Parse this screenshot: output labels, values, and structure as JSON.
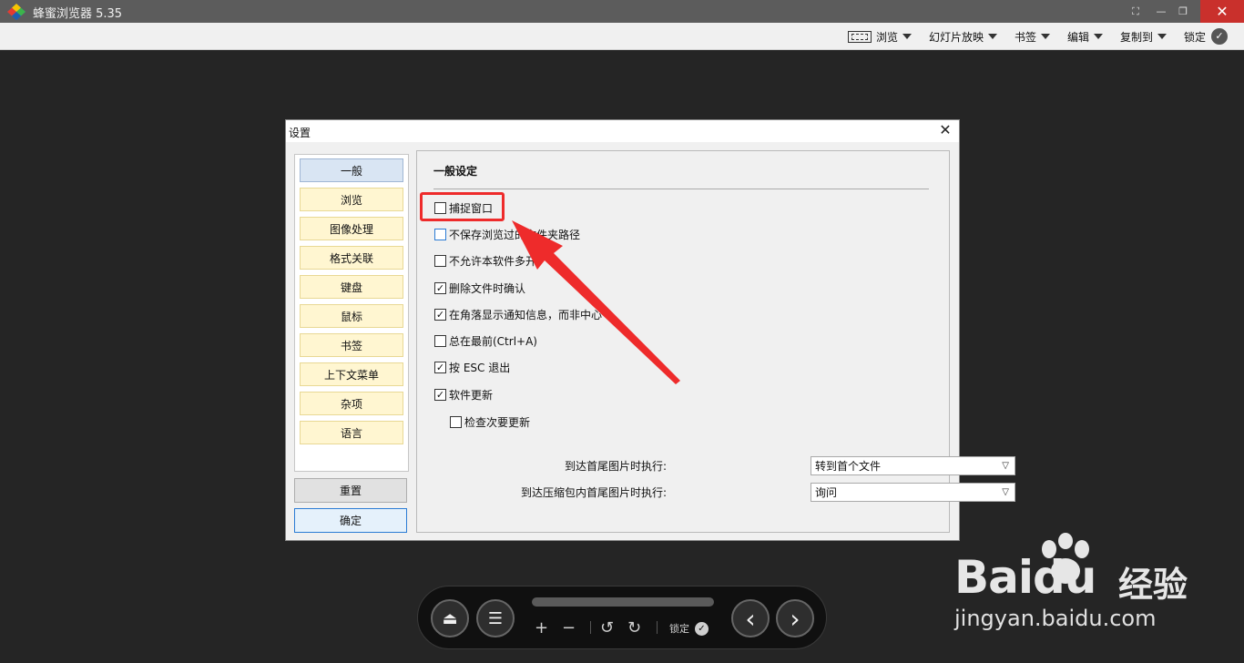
{
  "app": {
    "title": "蜂蜜浏览器 5.35",
    "window_controls": {
      "fullscreen": "⛶",
      "minimize": "—",
      "maximize": "❐",
      "close": "✕"
    }
  },
  "menubar": {
    "items": [
      {
        "label": "浏览",
        "icon": "view-frame-icon"
      },
      {
        "label": "幻灯片放映"
      },
      {
        "label": "书签"
      },
      {
        "label": "编辑"
      },
      {
        "label": "复制到"
      }
    ],
    "lock_label": "锁定"
  },
  "dialog": {
    "title": "设置",
    "nav": [
      "一般",
      "浏览",
      "图像处理",
      "格式关联",
      "键盘",
      "鼠标",
      "书签",
      "上下文菜单",
      "杂项",
      "语言"
    ],
    "active_nav": "一般",
    "reset_label": "重置",
    "ok_label": "确定",
    "section_title": "一般设定",
    "options": [
      {
        "label": "捕捉窗口",
        "checked": false
      },
      {
        "label": "不保存浏览过的文件夹路径",
        "checked": false
      },
      {
        "label": "不允许本软件多开",
        "checked": false
      },
      {
        "label": "删除文件时确认",
        "checked": true
      },
      {
        "label": "在角落显示通知信息，而非中心",
        "checked": true
      },
      {
        "label": "总在最前(Ctrl+A)",
        "checked": false
      },
      {
        "label": "按 ESC 退出",
        "checked": true
      },
      {
        "label": "软件更新",
        "checked": true
      },
      {
        "label": "检查次要更新",
        "checked": false
      }
    ],
    "fields": [
      {
        "label": "到达首尾图片时执行:",
        "value": "转到首个文件"
      },
      {
        "label": "到达压缩包内首尾图片时执行:",
        "value": "询问"
      }
    ]
  },
  "controls": {
    "eject": "⏏",
    "menu": "☰",
    "zoom_in": "+",
    "zoom_out": "−",
    "rotate_left": "↺",
    "rotate_right": "↻",
    "lock_label": "锁定",
    "prev": "‹",
    "next": "›"
  },
  "watermark": {
    "brand": "Bai",
    "brand_du": "du",
    "jingyan": "经验",
    "url": "jingyan.baidu.com"
  },
  "colors": {
    "highlight": "#ee2b2b",
    "close_button": "#c9302c",
    "nav_item": "#fff6d1",
    "nav_active": "#d9e5f3"
  }
}
